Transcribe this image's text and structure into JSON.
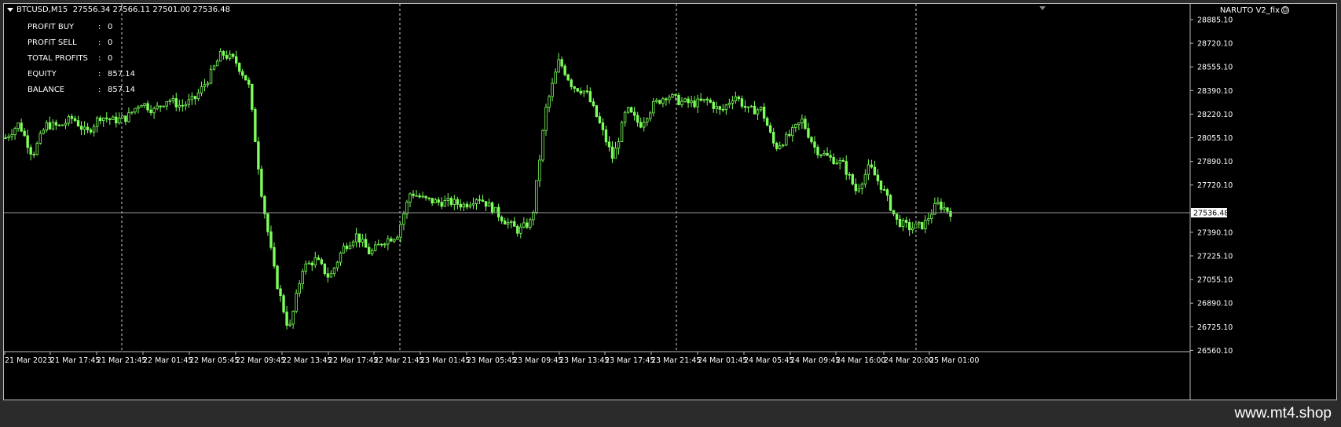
{
  "header": {
    "symbol": "BTCUSD,M15",
    "ohlc": "27556.34 27566.11 27501.00 27536.48"
  },
  "expert": {
    "name": "NARUTO V2_fix"
  },
  "info_panel": [
    {
      "label": "PROFIT BUY",
      "value": "0"
    },
    {
      "label": "PROFIT SELL",
      "value": "0"
    },
    {
      "label": "TOTAL PROFITS",
      "value": "0"
    },
    {
      "label": "EQUITY",
      "value": "857.14"
    },
    {
      "label": "BALANCE",
      "value": "857.14"
    }
  ],
  "watermark": "www.mt4.shop",
  "colors": {
    "candle": "#7cff5a",
    "background": "#000000",
    "text": "#ffffff",
    "bid_line": "#9a9a9a"
  },
  "chart_data": {
    "type": "candlestick",
    "symbol": "BTCUSD",
    "timeframe": "M15",
    "y_ticks": [
      28885.1,
      28720.1,
      28555.1,
      28390.1,
      28220.1,
      28055.1,
      27890.1,
      27720.1,
      27536.48,
      27390.1,
      27225.1,
      27055.1,
      26890.1,
      26725.1,
      26560.1
    ],
    "current_price": "27536.48",
    "x_ticks": [
      "21 Mar 2023",
      "21 Mar 17:45",
      "21 Mar 21:45",
      "22 Mar 01:45",
      "22 Mar 05:45",
      "22 Mar 09:45",
      "22 Mar 13:45",
      "22 Mar 17:45",
      "22 Mar 21:45",
      "23 Mar 01:45",
      "23 Mar 05:45",
      "23 Mar 09:45",
      "23 Mar 13:45",
      "23 Mar 17:45",
      "23 Mar 21:45",
      "24 Mar 01:45",
      "24 Mar 05:45",
      "24 Mar 09:45",
      "24 Mar 16:00",
      "24 Mar 20:00",
      "25 Mar 01:00"
    ],
    "day_separators": [
      "21 Mar 21:45",
      "22 Mar 21:45",
      "23 Mar 21:45",
      "24 Mar 20:00"
    ],
    "price_path": [
      28060,
      28160,
      27940,
      28150,
      28140,
      28200,
      28090,
      28210,
      28180,
      28200,
      28310,
      28250,
      28330,
      28280,
      28330,
      28470,
      28650,
      28600,
      28440,
      27650,
      27080,
      26710,
      27150,
      27210,
      27080,
      27290,
      27380,
      27250,
      27340,
      27380,
      27680,
      27630,
      27610,
      27610,
      27590,
      27650,
      27570,
      27480,
      27410,
      27480,
      28250,
      28600,
      28420,
      28380,
      28160,
      27910,
      28260,
      28150,
      28290,
      28360,
      28310,
      28300,
      28320,
      28240,
      28360,
      28250,
      28260,
      27990,
      28070,
      28180,
      27980,
      27920,
      27880,
      27690,
      27860,
      27700,
      27480,
      27430,
      27450,
      27600,
      27540
    ]
  }
}
